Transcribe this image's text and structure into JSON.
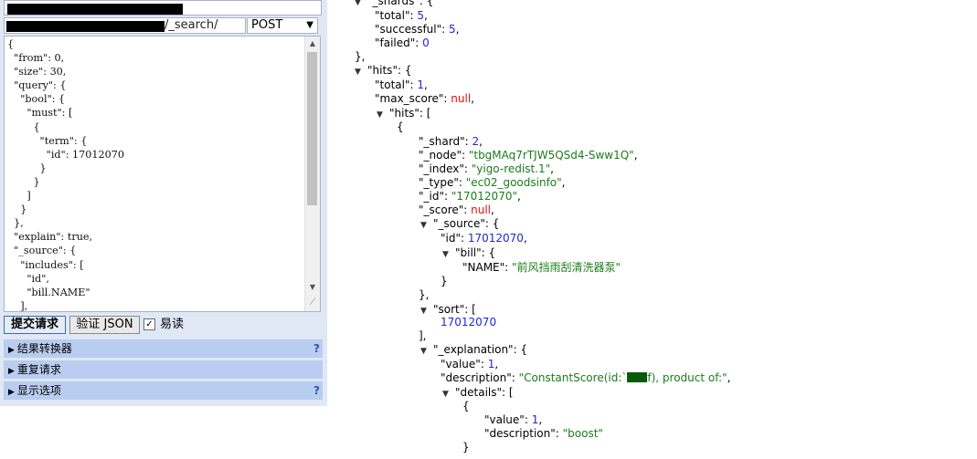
{
  "request": {
    "path": "/_search/",
    "method": "POST",
    "body_lines": [
      "{",
      "  \"from\": 0,",
      "  \"size\": 30,",
      "  \"query\": {",
      "    \"bool\": {",
      "      \"must\": [",
      "        {",
      "          \"term\": {",
      "            \"id\": 17012070",
      "          }",
      "        }",
      "      ]",
      "    }",
      "  },",
      "  \"explain\": true,",
      "  \"_source\": {",
      "    \"includes\": [",
      "      \"id\",",
      "      \"bill.NAME\"",
      "    ],"
    ]
  },
  "actions": {
    "submit": "提交请求",
    "validate": "验证 JSON",
    "pretty": "易读",
    "pretty_checked": true
  },
  "sections": [
    {
      "label": "结果转换器",
      "help": "?"
    },
    {
      "label": "重复请求",
      "help": ""
    },
    {
      "label": "显示选项",
      "help": "?"
    }
  ],
  "response": {
    "shards_key": "_shards",
    "shards": {
      "total": "5",
      "successful": "5",
      "failed": "0"
    },
    "hits_key": "hits",
    "hits_total": "1",
    "max_score": "null",
    "hit": {
      "_shard": "2",
      "_node": "\"tbgMAq7rTJW5QSd4-Sww1Q\"",
      "_index": "\"yigo-redist.1\"",
      "_type": "\"ec02_goodsinfo\"",
      "_id": "\"17012070\"",
      "_score": "null",
      "source_id": "17012070",
      "bill_name": "\"前风挡雨刮清洗器泵\"",
      "sort_value": "17012070",
      "explanation_value": "1",
      "explanation_description_pre": "\"ConstantScore(id:`",
      "explanation_description_post": "f), product of:\"",
      "detail_value": "1",
      "detail_description": "\"boost\""
    }
  },
  "colors": {
    "panel_bg": "#dfe8f4",
    "section_bg": "#b9cdf0",
    "json_number": "#1f27d8",
    "json_string": "#1a7d1a",
    "json_null": "#d11"
  }
}
